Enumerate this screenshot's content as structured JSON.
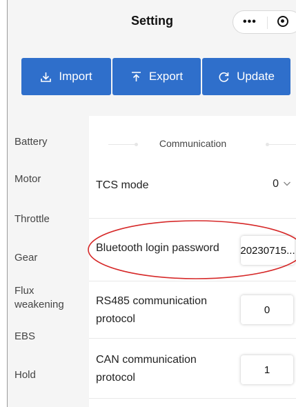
{
  "header": {
    "title": "Setting",
    "more_icon": "more-dots-icon",
    "target_icon": "target-icon"
  },
  "actions": {
    "import_label": "Import",
    "export_label": "Export",
    "update_label": "Update"
  },
  "sidebar": {
    "items": [
      "Battery",
      "Motor",
      "Throttle",
      "Gear",
      "Flux",
      "weakening",
      "EBS",
      "Hold"
    ]
  },
  "section": {
    "title": "Communication"
  },
  "settings": {
    "tcs_label": "TCS mode",
    "tcs_value": "0",
    "bt_label": "Bluetooth login password",
    "bt_value": "20230715...",
    "rs485_label_1": "RS485 communication",
    "rs485_label_2": "protocol",
    "rs485_value": "0",
    "can_label_1": "CAN communication",
    "can_label_2": "protocol",
    "can_value": "1"
  },
  "colors": {
    "accent": "#2f6fcb",
    "annotation": "#d62828",
    "panel": "#f5f5f5"
  }
}
